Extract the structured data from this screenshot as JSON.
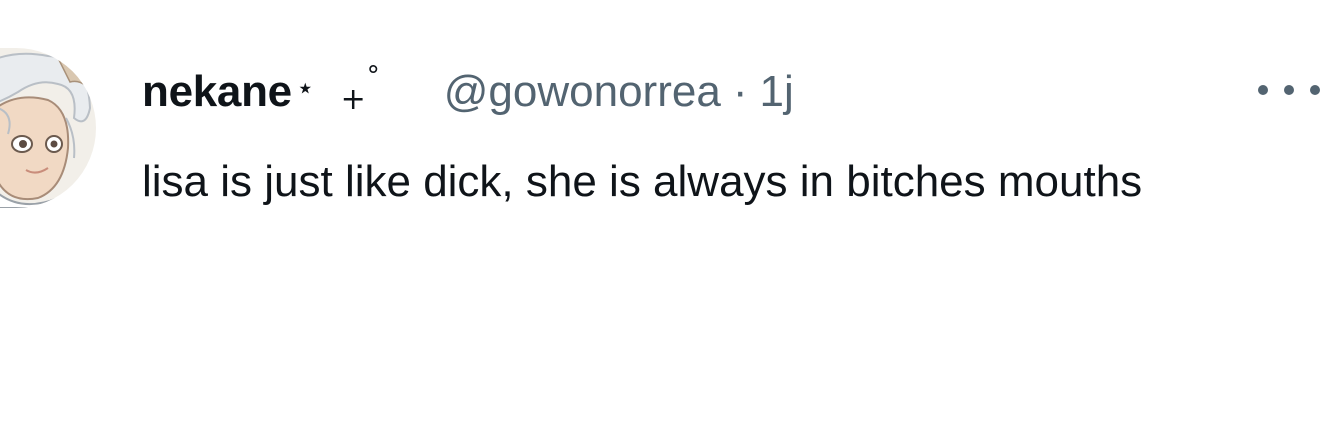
{
  "tweet": {
    "avatar_icon": "anime-avatar-icon",
    "display_name": "nekane",
    "name_decoration": "⋆",
    "name_decoration_2": "+",
    "name_decoration_3": "°",
    "handle": "@gowonorrea",
    "separator": "·",
    "time": "1j",
    "more_icon": "more-horizontal-icon",
    "text": "lisa is just like dick, she is always in bitches mouths"
  },
  "colors": {
    "primary_text": "#0f1419",
    "secondary_text": "#536471",
    "background": "#ffffff"
  }
}
